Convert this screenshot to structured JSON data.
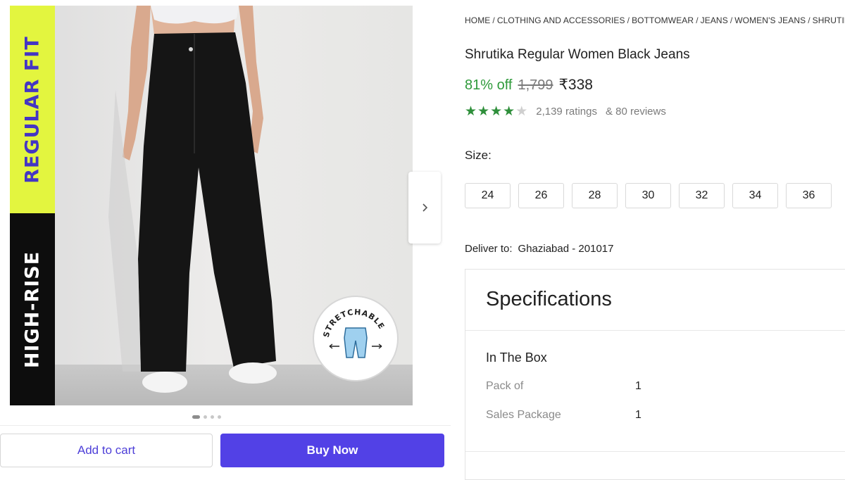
{
  "gallery": {
    "band_top_text": "REGULAR FIT",
    "band_bottom_text": "HIGH-RISE",
    "badge_text": "STRETCHABLE",
    "dots_count": 4,
    "active_dot": 1
  },
  "actions": {
    "add_to_cart": "Add to cart",
    "buy_now": "Buy Now"
  },
  "breadcrumb": [
    "HOME",
    "CLOTHING AND ACCESSORIES",
    "BOTTOMWEAR",
    "JEANS",
    "WOMEN'S JEANS",
    "SHRUTIKA"
  ],
  "product": {
    "title": "Shrutika Regular Women Black Jeans",
    "discount": "81% off",
    "mrp": "1,799",
    "price": "₹338",
    "rating_stars": 4,
    "ratings_text": "2,139 ratings",
    "reviews_text": "& 80 reviews"
  },
  "size": {
    "label": "Size:",
    "options": [
      "24",
      "26",
      "28",
      "30",
      "32",
      "34",
      "36"
    ]
  },
  "delivery": {
    "label": "Deliver to:",
    "location": "Ghaziabad - 201017"
  },
  "specifications": {
    "title": "Specifications",
    "group": "In The Box",
    "rows": [
      {
        "key": "Pack of",
        "value": "1"
      },
      {
        "key": "Sales Package",
        "value": "1"
      }
    ]
  },
  "colors": {
    "accent": "#5241e6",
    "discount_green": "#2e9a3a",
    "band_yellow": "#e3f53f"
  }
}
